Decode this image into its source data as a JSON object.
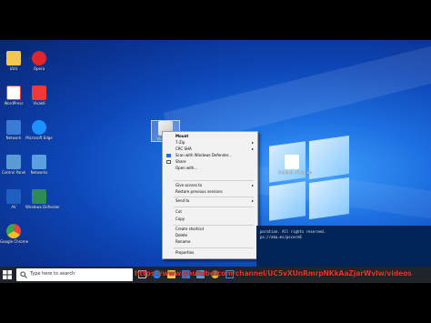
{
  "desktop_icons": [
    {
      "label": "UUU",
      "color": "#f2c94c",
      "icon": "folder-icon"
    },
    {
      "label": "Opera",
      "color": "#e0262b",
      "icon": "opera-icon"
    },
    {
      "label": "WordPress",
      "color": "#d44",
      "icon": "document-icon"
    },
    {
      "label": "Vivaldi",
      "color": "#ef3939",
      "icon": "vivaldi-icon"
    },
    {
      "label": "Network",
      "color": "#3a7bd5",
      "icon": "network-icon"
    },
    {
      "label": "Microsoft Edge",
      "color": "#1e90ff",
      "icon": "edge-icon"
    },
    {
      "label": "Control Panel",
      "color": "#5a9bd4",
      "icon": "control-panel-icon"
    },
    {
      "label": "Networks",
      "color": "#5aa0e0",
      "icon": "network-icon"
    },
    {
      "label": "AV",
      "color": "#1f5fbf",
      "icon": "app-icon"
    },
    {
      "label": "Windows Defender",
      "color": "#2e8b57",
      "icon": "shield-icon"
    },
    {
      "label": "Google Chrome",
      "color": "#e8453c",
      "icon": "chrome-icon"
    }
  ],
  "iso_file": {
    "label": "Win10.iso",
    "icon": "disc-image-icon"
  },
  "desktop_file": {
    "label": "Untitled - Notepad",
    "icon": "text-file-icon"
  },
  "context_menu": {
    "items": [
      {
        "label": "Mount",
        "bold": true,
        "submenu": false
      },
      {
        "label": "7-Zip",
        "bold": false,
        "submenu": true
      },
      {
        "label": "CRC SHA",
        "bold": false,
        "submenu": true
      },
      {
        "label": "Scan with Windows Defender...",
        "bold": false,
        "submenu": false
      },
      {
        "label": "Share",
        "bold": false,
        "submenu": false
      },
      {
        "label": "Open with...",
        "bold": false,
        "submenu": false
      },
      {
        "label": "Give access to",
        "bold": false,
        "submenu": true
      },
      {
        "label": "Restore previous versions",
        "bold": false,
        "submenu": false
      },
      {
        "label": "Send to",
        "bold": false,
        "submenu": true
      },
      {
        "label": "Cut",
        "bold": false,
        "submenu": false
      },
      {
        "label": "Copy",
        "bold": false,
        "submenu": false
      },
      {
        "label": "Create shortcut",
        "bold": false,
        "submenu": false
      },
      {
        "label": "Delete",
        "bold": false,
        "submenu": false
      },
      {
        "label": "Rename",
        "bold": false,
        "submenu": false
      },
      {
        "label": "Properties",
        "bold": false,
        "submenu": false
      }
    ]
  },
  "terminal": {
    "line1": "poration. All rights reserved.",
    "line2": "ps://aka.ms/pscore6"
  },
  "taskbar": {
    "search_placeholder": "Type here to search",
    "url_overlay": "https://www.youtube.com/channel/UC5vXUnRmrpNKkAaZjarWvIw/videos",
    "clock_time": "",
    "clock_date": ""
  }
}
